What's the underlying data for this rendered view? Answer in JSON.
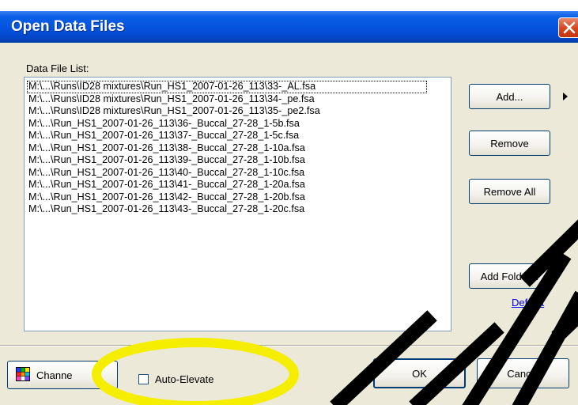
{
  "dialog": {
    "title": "Open Data Files",
    "file_list_label": "Data File List:",
    "files": [
      "M:\\...\\Runs\\ID28 mixtures\\Run_HS1_2007-01-26_113\\33-_AL.fsa",
      "M:\\...\\Runs\\ID28 mixtures\\Run_HS1_2007-01-26_113\\34-_pe.fsa",
      "M:\\...\\Runs\\ID28 mixtures\\Run_HS1_2007-01-26_113\\35-_pe2.fsa",
      "M:\\...\\Run_HS1_2007-01-26_113\\36-_Buccal_27-28_1-5b.fsa",
      "M:\\...\\Run_HS1_2007-01-26_113\\37-_Buccal_27-28_1-5c.fsa",
      "M:\\...\\Run_HS1_2007-01-26_113\\38-_Buccal_27-28_1-10a.fsa",
      "M:\\...\\Run_HS1_2007-01-26_113\\39-_Buccal_27-28_1-10b.fsa",
      "M:\\...\\Run_HS1_2007-01-26_113\\40-_Buccal_27-28_1-10c.fsa",
      "M:\\...\\Run_HS1_2007-01-26_113\\41-_Buccal_27-28_1-20a.fsa",
      "M:\\...\\Run_HS1_2007-01-26_113\\42-_Buccal_27-28_1-20b.fsa",
      "M:\\...\\Run_HS1_2007-01-26_113\\43-_Buccal_27-28_1-20c.fsa"
    ],
    "buttons": {
      "add": "Add...",
      "remove": "Remove",
      "remove_all": "Remove All",
      "add_folder": "Add Folder...",
      "default_link": "Default",
      "channels": "Channe",
      "ok": "OK",
      "cancel": "Cancel"
    },
    "auto_elevate": {
      "label": "Auto-Elevate",
      "checked": false
    }
  },
  "colors": {
    "titlebar": "#0453de",
    "close_button": "#d6451d",
    "dialog_background": "#ece9d8",
    "highlight": "#f5ee00",
    "link": "#0000ee"
  }
}
